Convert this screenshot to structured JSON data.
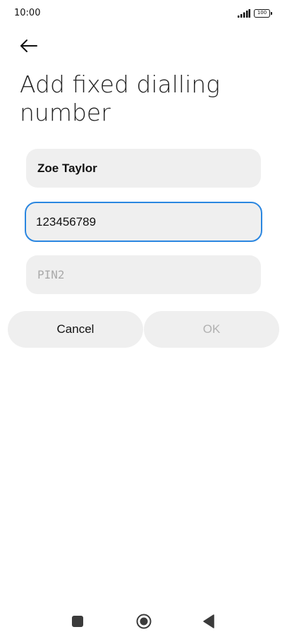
{
  "status_bar": {
    "time": "10:00",
    "battery": "100"
  },
  "header": {
    "title": "Add fixed dialling number"
  },
  "form": {
    "name_value": "Zoe Taylor",
    "number_value": "123456789",
    "pin_placeholder": "PIN2"
  },
  "actions": {
    "cancel_label": "Cancel",
    "ok_label": "OK"
  },
  "colors": {
    "focus_border": "#2a86e0",
    "field_background": "#efefef",
    "disabled_text": "#b1b1b1"
  },
  "icons": {
    "back": "arrow-left-icon",
    "signal": "signal-icon",
    "battery": "battery-icon",
    "nav_recents": "square-icon",
    "nav_home": "circle-icon",
    "nav_back": "triangle-back-icon"
  }
}
